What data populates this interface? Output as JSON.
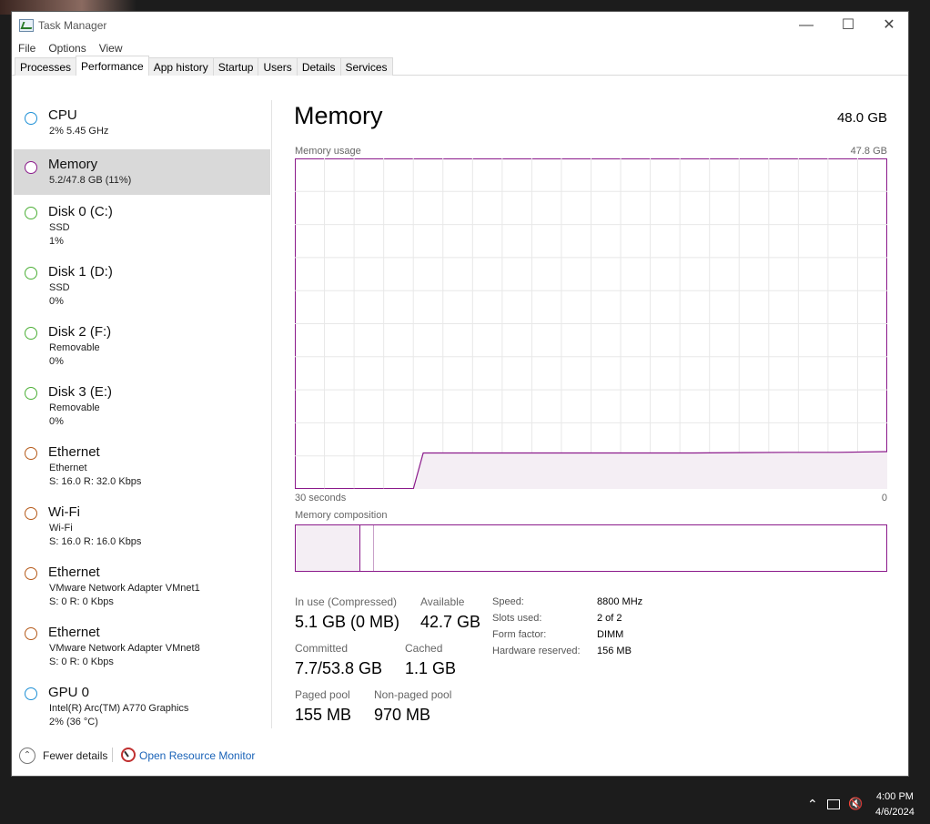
{
  "window": {
    "title": "Task Manager"
  },
  "menu": [
    "File",
    "Options",
    "View"
  ],
  "tabs": [
    "Processes",
    "Performance",
    "App history",
    "Startup",
    "Users",
    "Details",
    "Services"
  ],
  "sidebar": [
    {
      "name": "CPU",
      "l1": "2%  5.45 GHz",
      "color": "#1e90d6"
    },
    {
      "name": "Memory",
      "l1": "5.2/47.8 GB (11%)",
      "color": "#8b1a8b"
    },
    {
      "name": "Disk 0 (C:)",
      "l1": "SSD",
      "l2": "1%",
      "color": "#4caf37"
    },
    {
      "name": "Disk 1 (D:)",
      "l1": "SSD",
      "l2": "0%",
      "color": "#4caf37"
    },
    {
      "name": "Disk 2 (F:)",
      "l1": "Removable",
      "l2": "0%",
      "color": "#4caf37"
    },
    {
      "name": "Disk 3 (E:)",
      "l1": "Removable",
      "l2": "0%",
      "color": "#4caf37"
    },
    {
      "name": "Ethernet",
      "l1": "Ethernet",
      "s": "S:",
      "sv": "16.0",
      "r": "R:",
      "rv": "32.0 Kbps",
      "color": "#b55a1a"
    },
    {
      "name": "Wi-Fi",
      "l1": "Wi-Fi",
      "s": "S:",
      "sv": "16.0",
      "r": "R:",
      "rv": "16.0 Kbps",
      "color": "#b55a1a"
    },
    {
      "name": "Ethernet",
      "l1": "VMware Network Adapter VMnet1",
      "s": "S:",
      "sv": "0",
      "r": "R:",
      "rv": "0 Kbps",
      "color": "#b55a1a"
    },
    {
      "name": "Ethernet",
      "l1": "VMware Network Adapter VMnet8",
      "s": "S:",
      "sv": "0",
      "r": "R:",
      "rv": "0 Kbps",
      "color": "#b55a1a"
    },
    {
      "name": "GPU 0",
      "l1": "Intel(R) Arc(TM) A770 Graphics",
      "l2": "2% (36 °C)",
      "color": "#1e90d6"
    }
  ],
  "main": {
    "title": "Memory",
    "total": "48.0 GB",
    "usage_label": "Memory usage",
    "usage_max": "47.8 GB",
    "time_label": "30 seconds",
    "time_zero": "0",
    "composition_label": "Memory composition"
  },
  "stats": {
    "inuse_label": "In use (Compressed)",
    "inuse": "5.1 GB (0 MB)",
    "available_label": "Available",
    "available": "42.7 GB",
    "committed_label": "Committed",
    "committed": "7.7/53.8 GB",
    "cached_label": "Cached",
    "cached": "1.1 GB",
    "paged_label": "Paged pool",
    "paged": "155 MB",
    "nonpaged_label": "Non-paged pool",
    "nonpaged": "970 MB"
  },
  "specs": {
    "speed_label": "Speed:",
    "speed": "8800 MHz",
    "slots_label": "Slots used:",
    "slots": "2 of 2",
    "form_label": "Form factor:",
    "form": "DIMM",
    "hwres_label": "Hardware reserved:",
    "hwres": "156 MB"
  },
  "footer": {
    "fewer": "Fewer details",
    "resmon": "Open Resource Monitor"
  },
  "taskbar": {
    "time": "4:00 PM",
    "date": "4/6/2024"
  },
  "chart_data": {
    "type": "area",
    "title": "Memory usage",
    "xlabel": "30 seconds",
    "ylabel": "",
    "max_label": "47.8 GB",
    "ylim": [
      0,
      47.8
    ],
    "x": [
      60,
      48,
      47,
      45,
      40,
      35,
      30,
      25,
      20,
      15,
      10,
      5,
      0
    ],
    "values": [
      0,
      0,
      5.2,
      5.2,
      5.2,
      5.2,
      5.2,
      5.2,
      5.2,
      5.25,
      5.3,
      5.3,
      5.4
    ],
    "grid": true,
    "color": "#8b1a8b"
  }
}
